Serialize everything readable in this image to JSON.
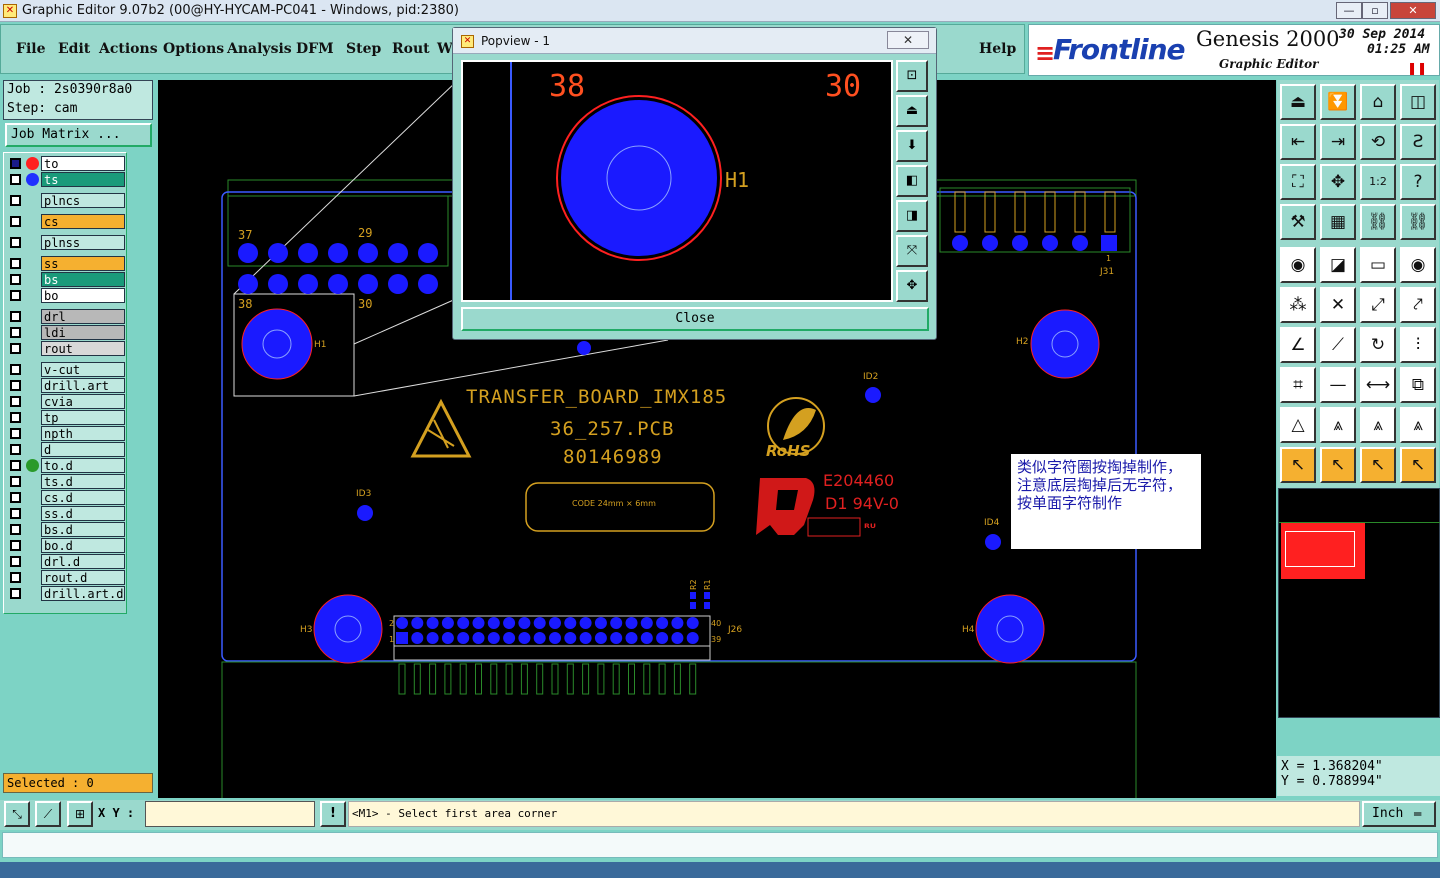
{
  "window": {
    "title": "Graphic Editor 9.07b2 (00@HY-HYCAM-PC041 - Windows, pid:2380)"
  },
  "menu": [
    "File",
    "Edit",
    "Actions",
    "Options",
    "Analysis",
    "DFM",
    "Step",
    "Rout",
    "W",
    "Help"
  ],
  "brand": {
    "logo": "Frontline",
    "product": "Genesis 2000",
    "subtitle": "Graphic Editor",
    "date": "30 Sep 2014",
    "time": "01:25 AM"
  },
  "job": {
    "job": "Job : 2s0390r8a0",
    "step": "Step: cam",
    "matrix": "Job Matrix ..."
  },
  "layers": [
    {
      "name": "to",
      "color": "#ffffff",
      "dot": "#ff2020"
    },
    {
      "name": "ts",
      "color": "#1a9a7a",
      "dot": "#2030ff"
    },
    {
      "name": "plncs",
      "color": "#bfe8e0"
    },
    {
      "name": "cs",
      "color": "#f5b030"
    },
    {
      "name": "plnss",
      "color": "#bfe8e0"
    },
    {
      "name": "ss",
      "color": "#f5b030"
    },
    {
      "name": "bs",
      "color": "#1a9a7a"
    },
    {
      "name": "bo",
      "color": "#ffffff"
    },
    {
      "name": "drl",
      "color": "#b8b8b8"
    },
    {
      "name": "ldi",
      "color": "#b8b8b8"
    },
    {
      "name": "rout",
      "color": "#d8d8d8"
    },
    {
      "name": "v-cut",
      "color": "#bfe8e0"
    },
    {
      "name": "drill.art",
      "color": "#bfe8e0"
    },
    {
      "name": "cvia",
      "color": "#bfe8e0"
    },
    {
      "name": "tp",
      "color": "#bfe8e0"
    },
    {
      "name": "npth",
      "color": "#bfe8e0"
    },
    {
      "name": "d",
      "color": "#bfe8e0"
    },
    {
      "name": "to.d",
      "color": "#bfe8e0",
      "dot": "#2a9a2a"
    },
    {
      "name": "ts.d",
      "color": "#bfe8e0"
    },
    {
      "name": "cs.d",
      "color": "#bfe8e0"
    },
    {
      "name": "ss.d",
      "color": "#bfe8e0"
    },
    {
      "name": "bs.d",
      "color": "#bfe8e0"
    },
    {
      "name": "bo.d",
      "color": "#bfe8e0"
    },
    {
      "name": "drl.d",
      "color": "#bfe8e0"
    },
    {
      "name": "rout.d",
      "color": "#bfe8e0"
    },
    {
      "name": "drill.art.d",
      "color": "#bfe8e0"
    }
  ],
  "selected": "Selected : 0",
  "popview": {
    "title": "Popview - 1",
    "close": "Close",
    "pin_left": "38",
    "pin_right": "30",
    "hole": "H1"
  },
  "board": {
    "text1": "TRANSFER_BOARD_IMX185",
    "text2": "36_257.PCB",
    "text3": "80146989",
    "code": "CODE 24mm × 6mm",
    "ul": "E204460",
    "rating": "D1 94V-0",
    "rohs": "RoHS",
    "labels": {
      "h1": "H1",
      "h2": "H2",
      "h3": "H3",
      "h4": "H4",
      "id2": "ID2",
      "id3": "ID3",
      "id4": "ID4",
      "j31": "J31",
      "j26": "J26",
      "n37": "37",
      "n29": "29",
      "n38": "38",
      "n30": "30",
      "r1": "R1",
      "r2": "R2",
      "p2": "2",
      "p1": "1",
      "p40": "40",
      "p39": "39",
      "j31n": "1"
    }
  },
  "note": "类似字符圈按掏掉制作，注意底层掏掉后无字符，按单面字符制作",
  "coords": {
    "x": "X  =  1.368204\"",
    "y": "Y  =  0.788994\""
  },
  "status": {
    "xy_label": "X Y :",
    "prompt": "<M1> - Select first area corner",
    "units": "Inch"
  },
  "colors": {
    "canvas": "#000000",
    "pad": "#1a1aff",
    "outline": "#ff2020",
    "silk": "#d4a020"
  }
}
